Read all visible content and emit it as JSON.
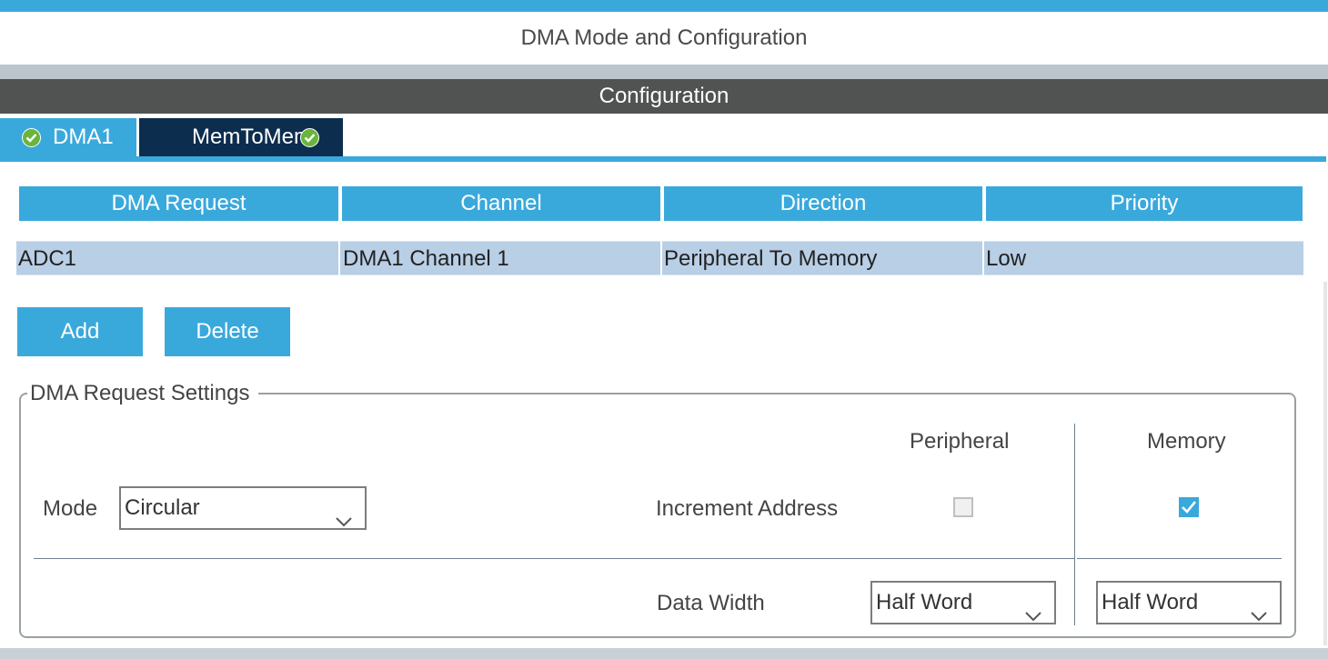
{
  "window": {
    "title": "DMA Mode and Configuration"
  },
  "section": {
    "title": "Configuration"
  },
  "tabs": [
    {
      "label": "DMA1",
      "status": "ok"
    },
    {
      "label": "MemToMem",
      "status": "ok"
    }
  ],
  "table": {
    "headers": [
      "DMA Request",
      "Channel",
      "Direction",
      "Priority"
    ],
    "rows": [
      [
        "ADC1",
        "DMA1 Channel 1",
        "Peripheral To Memory",
        "Low"
      ]
    ]
  },
  "buttons": {
    "add": "Add",
    "delete": "Delete"
  },
  "settings": {
    "legend": "DMA Request Settings",
    "mode_label": "Mode",
    "mode_value": "Circular",
    "peripheral_header": "Peripheral",
    "memory_header": "Memory",
    "increment_label": "Increment Address",
    "increment_peripheral": false,
    "increment_memory": true,
    "data_width_label": "Data Width",
    "data_width_peripheral": "Half Word",
    "data_width_memory": "Half Word"
  },
  "colors": {
    "accent": "#39a9dc",
    "selected_tab": "#0c2d4e",
    "config_bar": "#505352",
    "row_selected": "#b8cfe6",
    "status_ok": "#6ab43d"
  }
}
